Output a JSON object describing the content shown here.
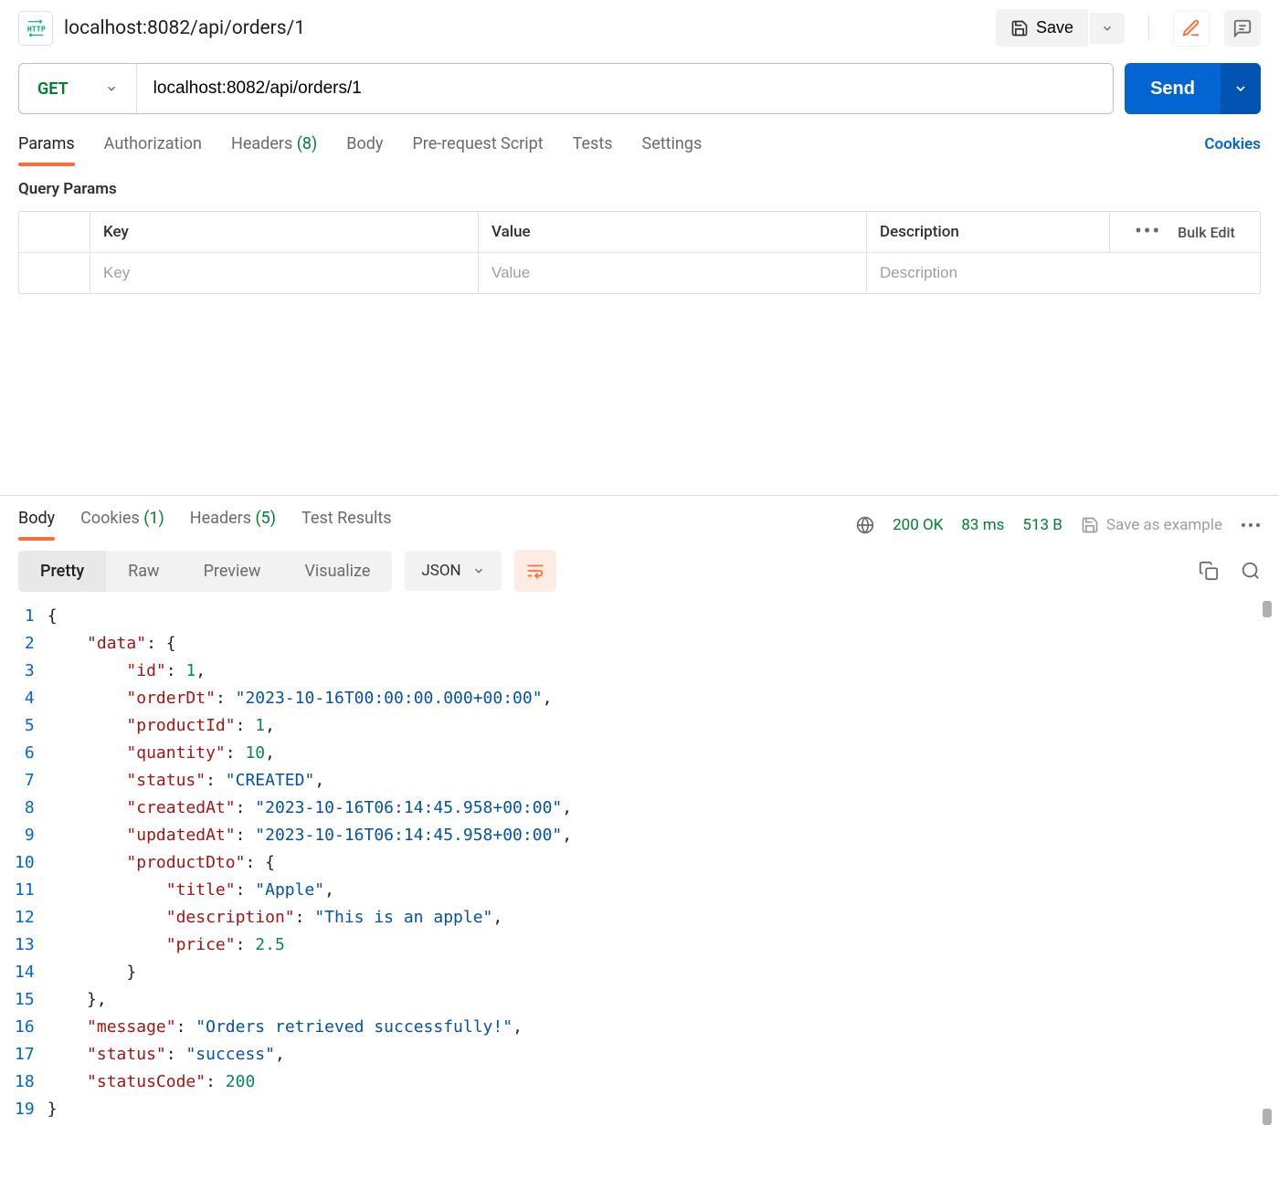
{
  "header": {
    "tab_title": "localhost:8082/api/orders/1",
    "save_label": "Save"
  },
  "request": {
    "method": "GET",
    "url": "localhost:8082/api/orders/1",
    "send_label": "Send"
  },
  "req_tabs": {
    "params": "Params",
    "auth": "Authorization",
    "headers_label": "Headers",
    "headers_count": "(8)",
    "body": "Body",
    "prereq": "Pre-request Script",
    "tests": "Tests",
    "settings": "Settings",
    "cookies": "Cookies"
  },
  "params_section": {
    "title": "Query Params",
    "cols": {
      "key": "Key",
      "value": "Value",
      "desc": "Description"
    },
    "placeholders": {
      "key": "Key",
      "value": "Value",
      "desc": "Description"
    },
    "bulk_edit": "Bulk Edit"
  },
  "resp_tabs": {
    "body": "Body",
    "cookies_label": "Cookies",
    "cookies_count": "(1)",
    "headers_label": "Headers",
    "headers_count": "(5)",
    "test_results": "Test Results"
  },
  "resp_meta": {
    "status": "200 OK",
    "time": "83 ms",
    "size": "513 B",
    "save_example": "Save as example"
  },
  "view": {
    "pretty": "Pretty",
    "raw": "Raw",
    "preview": "Preview",
    "visualize": "Visualize",
    "format": "JSON"
  },
  "response_body": {
    "data": {
      "id": 1,
      "orderDt": "2023-10-16T00:00:00.000+00:00",
      "productId": 1,
      "quantity": 10,
      "status": "CREATED",
      "createdAt": "2023-10-16T06:14:45.958+00:00",
      "updatedAt": "2023-10-16T06:14:45.958+00:00",
      "productDto": {
        "title": "Apple",
        "description": "This is an apple",
        "price": 2.5
      }
    },
    "message": "Orders retrieved successfully!",
    "status": "success",
    "statusCode": 200
  },
  "line_numbers": [
    "1",
    "2",
    "3",
    "4",
    "5",
    "6",
    "7",
    "8",
    "9",
    "10",
    "11",
    "12",
    "13",
    "14",
    "15",
    "16",
    "17",
    "18",
    "19"
  ]
}
